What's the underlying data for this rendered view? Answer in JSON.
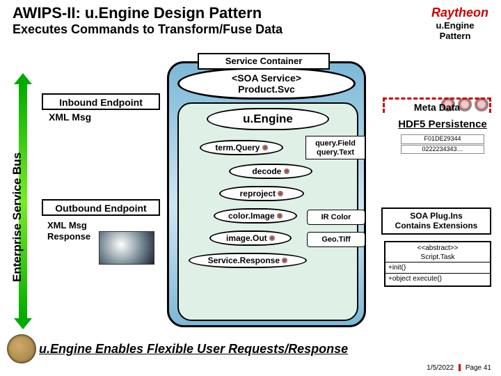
{
  "header": {
    "title": "AWIPS-II: u.Engine Design Pattern",
    "subtitle": "Executes Commands to Transform/Fuse Data",
    "logo_text": "Raytheon",
    "pattern_label_1": "u.Engine",
    "pattern_label_2": "Pattern"
  },
  "bus_label": "Enterprise Service Bus",
  "endpoints": {
    "inbound": "Inbound Endpoint",
    "xml_msg": "XML Msg",
    "outbound": "Outbound Endpoint",
    "xml_resp_1": "XML Msg",
    "xml_resp_2": "Response"
  },
  "svc": {
    "container_hdr": "Service Container",
    "soa_line1": "<SOA Service>",
    "soa_line2": "Product.Svc",
    "uengine": "u.Engine",
    "steps": {
      "termQuery": "term.Query",
      "decode": "decode",
      "reproject": "reproject",
      "colorImage": "color.Image",
      "imageOut": "image.Out",
      "serviceResponse": "Service.Response"
    },
    "queryField": {
      "l1": "query.Field",
      "l2": "query.Text"
    },
    "irColor": "IR Color",
    "geoTiff": "Geo.Tiff"
  },
  "right": {
    "meta": "Meta Data",
    "hdf5": "HDF5 Persistence",
    "code1": "F01DE29344",
    "code2": "0222234343…",
    "plugins_1": "SOA Plug.Ins",
    "plugins_2": "Contains Extensions",
    "abstract_hdr1": "<<abstract>>",
    "abstract_hdr2": "Script.Task",
    "abstract_m1": "+init()",
    "abstract_m2": "+object execute()"
  },
  "bottom": "u.Engine Enables Flexible User Requests/Response",
  "footer": {
    "date": "1/5/2022",
    "page": "Page 41"
  }
}
